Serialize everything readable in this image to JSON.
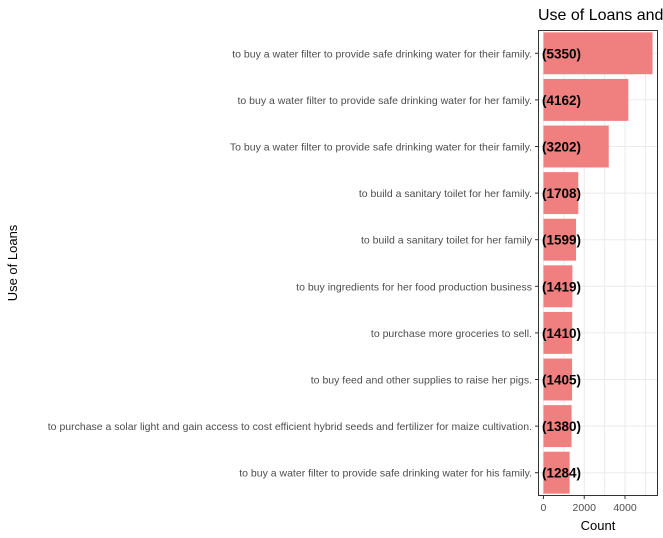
{
  "chart_data": {
    "type": "bar",
    "orientation": "horizontal",
    "title": "Use of Loans and",
    "xlabel": "Count",
    "ylabel": "Use of Loans",
    "categories": [
      "to buy a water filter to provide safe drinking water for their family.",
      "to buy a water filter to provide safe drinking water for her family.",
      "To buy a water filter to provide safe drinking water for their family.",
      "to build a sanitary toilet for her family.",
      "to build a sanitary toilet for her family",
      "to buy ingredients for her food production business",
      "to purchase more groceries to sell.",
      "to buy feed and other supplies to raise her pigs.",
      "to purchase a solar light and gain access to cost efficient hybrid seeds and fertilizer for maize cultivation.",
      "to buy a water filter to provide safe drinking water for his family."
    ],
    "values": [
      5350,
      4162,
      3202,
      1708,
      1599,
      1419,
      1410,
      1405,
      1380,
      1284
    ],
    "data_labels": [
      "(5350)",
      "(4162)",
      "(3202)",
      "(1708)",
      "(1599)",
      "(1419)",
      "(1410)",
      "(1405)",
      "(1380)",
      "(1284)"
    ],
    "xlim": [
      -267.5,
      5617.5
    ],
    "xticks": [
      0,
      2000,
      4000
    ],
    "xtick_labels": [
      "0",
      "2000",
      "4000"
    ],
    "bar_color": "#f08080",
    "grid": true,
    "grid_color": "#ebebeb",
    "panel_border_color": "#333333"
  }
}
